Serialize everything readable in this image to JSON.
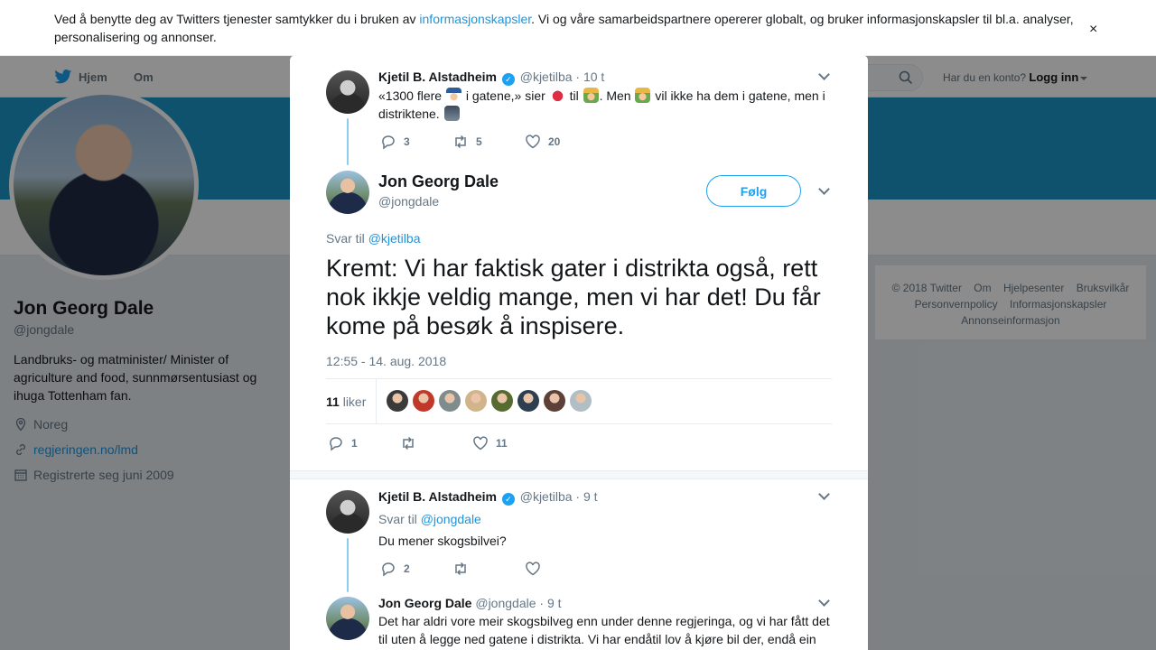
{
  "cookie_bar": {
    "text_before": "Ved å benytte deg av Twitters tjenester samtykker du i bruken av ",
    "link": "informasjonskapsler",
    "text_after": ". Vi og våre samarbeidspartnere opererer globalt, og bruker informasjonskapsler til bl.a. analyser, personalisering og annonser.",
    "close": "×"
  },
  "modal_close": "✕",
  "nav": {
    "home": "Hjem",
    "about": "Om",
    "account_prompt": "Har du en konto?",
    "login": "Logg inn"
  },
  "profile": {
    "name": "Jon Georg Dale",
    "handle": "@jongdale",
    "bio": "Landbruks- og matminister/ Minister of agriculture and food, sunnmørsentusiast og ihuga Tottenham fan.",
    "location": "Noreg",
    "website": "regjeringen.no/lmd",
    "joined": "Registrerte seg juni 2009"
  },
  "footer": {
    "links": [
      "© 2018 Twitter",
      "Om",
      "Hjelpesenter",
      "Bruksvilkår",
      "Personvernpolicy",
      "Informasjonskapsler",
      "Annonseinformasjon"
    ]
  },
  "tweets": {
    "parent": {
      "name": "Kjetil B. Alstadheim",
      "handle": "@kjetilba",
      "time": "· 10 t",
      "text_1": "«1300 flere ",
      "text_2": " i gatene,» sier ",
      "text_3": " til ",
      "text_4": ". Men ",
      "text_5": " vil ikke ha dem i gatene, men i distriktene. ",
      "emoji": [
        "police-officer-emoji",
        "apple-emoji",
        "farmer-emoji",
        "farmer-emoji",
        "ghost-emoji"
      ],
      "replies": "3",
      "retweets": "5",
      "likes": "20"
    },
    "main": {
      "name": "Jon Georg Dale",
      "handle": "@jongdale",
      "follow": "Følg",
      "reply_prefix": "Svar til ",
      "reply_to": "@kjetilba",
      "text": "Kremt: Vi har faktisk gater i distrikta også, rett nok ikkje veldig mange, men vi har det! Du får kome på besøk å inspisere.",
      "timestamp": "12:55 - 14. aug. 2018",
      "likes_count": "11",
      "likes_label": " liker",
      "likers": [
        "#3a3a3a",
        "#c0392b",
        "#7f8c8d",
        "#d2b48c",
        "#556b2f",
        "#2c3e50",
        "#5d4037",
        "#b0bec5"
      ],
      "replies": "1",
      "retweets": "",
      "likes": "11"
    },
    "reply1": {
      "name": "Kjetil B. Alstadheim",
      "handle": "@kjetilba",
      "time": "· 9 t",
      "reply_prefix": "Svar til ",
      "reply_to": "@jongdale",
      "text": "Du mener skogsbilvei?",
      "replies": "2",
      "retweets": "",
      "likes": ""
    },
    "reply2": {
      "name": "Jon Georg Dale",
      "handle": "@jongdale",
      "time": "· 9 t",
      "text": "Det har aldri vore meir skogsbilveg enn under denne regjeringa, og vi har fått det til uten å legge ned gatene i distrikta. Vi har endåtil lov å kjøre bil der, endå ein"
    }
  },
  "colors": {
    "accent": "#1da1f2",
    "link": "#1b95e0",
    "banner": "#1b95c9"
  }
}
